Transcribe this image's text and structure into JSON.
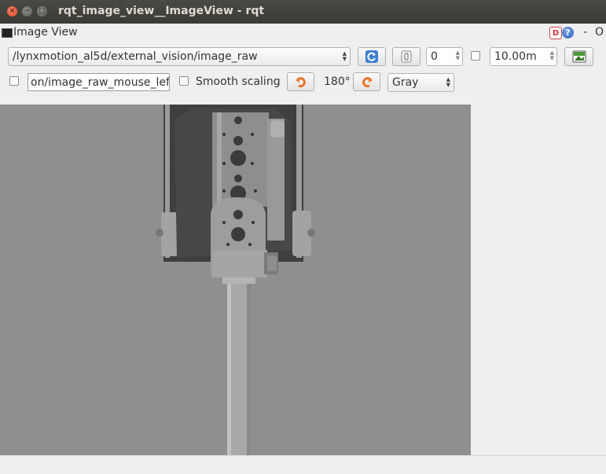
{
  "window": {
    "title": "rqt_image_view__ImageView - rqt",
    "close_glyph": "×",
    "minimize_glyph": "−",
    "maximize_glyph": "□"
  },
  "panel": {
    "title": "Image View",
    "d_label": "D",
    "help_label": "?",
    "minimize_label": "-",
    "close_label": "O"
  },
  "toolbar": {
    "topic": "/lynxmotion_al5d/external_vision/image_raw",
    "number_value": "0",
    "duration_value": "10.00m",
    "mouse_topic": "on/image_raw_mouse_left",
    "smooth_scaling_label": "Smooth scaling",
    "rotation_value": "180°",
    "color_scheme": "Gray"
  },
  "colors": {
    "image_background": "#8f8f8f",
    "accent_orange": "#e8742a",
    "refresh_blue": "#3f7fd1"
  }
}
